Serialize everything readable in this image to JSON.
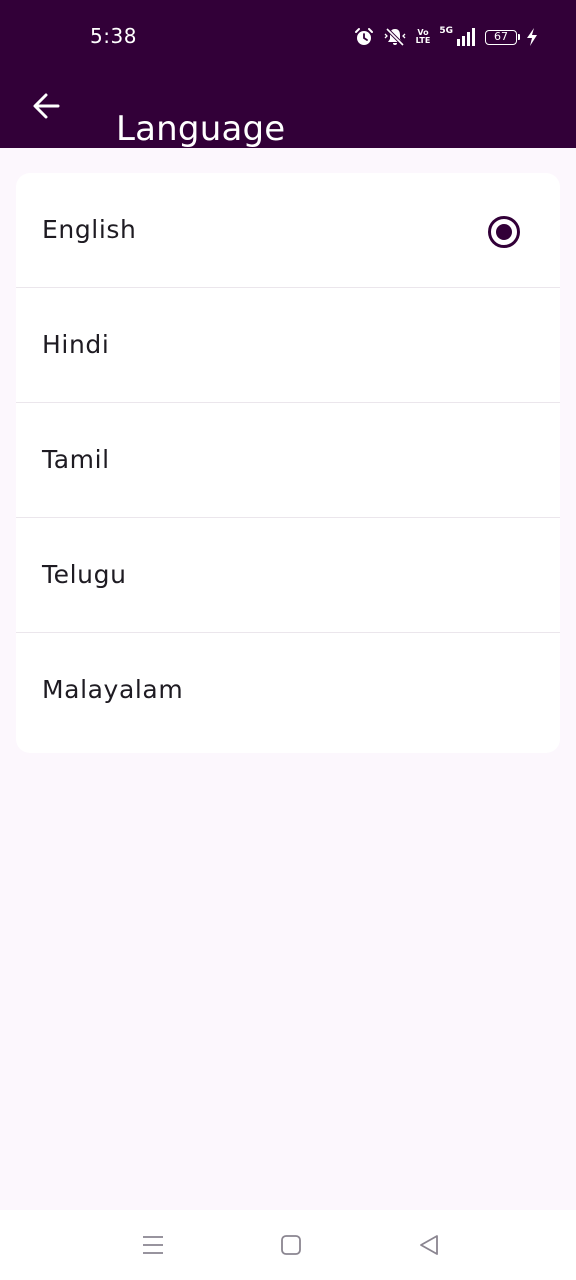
{
  "status_bar": {
    "time": "5:38",
    "volte_top": "Vo",
    "volte_bottom": "LTE",
    "network": "5G",
    "battery": "67",
    "icons": [
      "alarm-icon",
      "mute-icon",
      "volte-icon",
      "signal-icon",
      "battery-icon",
      "charging-icon"
    ]
  },
  "app_bar": {
    "title": "Language",
    "back_icon": "arrow-left-icon"
  },
  "languages": [
    {
      "label": "English",
      "selected": true
    },
    {
      "label": "Hindi",
      "selected": false
    },
    {
      "label": "Tamil",
      "selected": false
    },
    {
      "label": "Telugu",
      "selected": false
    },
    {
      "label": "Malayalam",
      "selected": false
    }
  ],
  "nav_bar": {
    "icons": [
      "menu-icon",
      "home-icon",
      "back-icon"
    ]
  },
  "colors": {
    "primary": "#320038",
    "background": "#fcf7fd",
    "card": "#ffffff",
    "text": "#1e1b22"
  }
}
